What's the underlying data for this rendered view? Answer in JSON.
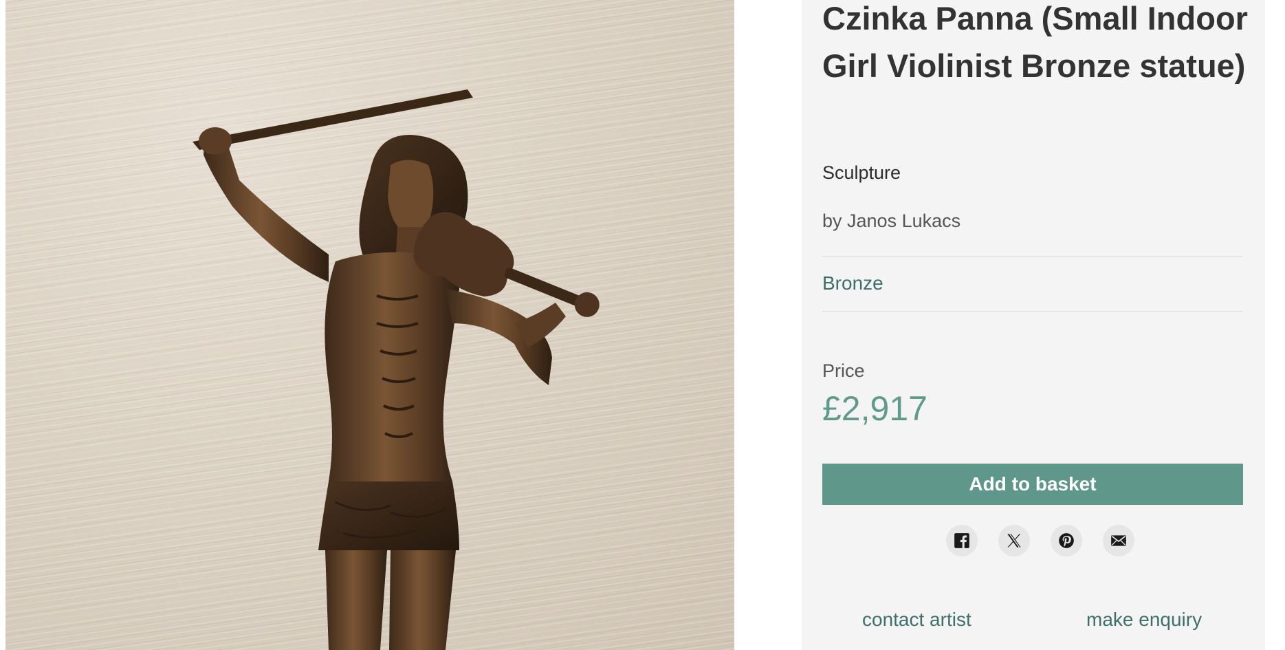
{
  "product": {
    "title": "Czinka Panna (Small Indoor Girl Violinist Bronze statue)",
    "category": "Sculpture",
    "artist": "by Janos Lukacs",
    "material": "Bronze",
    "price_label": "Price",
    "price": "£2,917"
  },
  "image": {
    "subject": "Bronze statue of a girl playing the violin against a textured cream wall"
  },
  "actions": {
    "add_to_basket": "Add to basket",
    "contact_artist": "contact artist",
    "make_enquiry": "make enquiry"
  },
  "share": {
    "icons": [
      "facebook-icon",
      "x-icon",
      "pinterest-icon",
      "email-icon"
    ]
  },
  "colors": {
    "accent": "#5f978a",
    "link": "#3f6f6b",
    "panel_bg": "#f4f4f4",
    "bronze": "#6b4a2e"
  }
}
